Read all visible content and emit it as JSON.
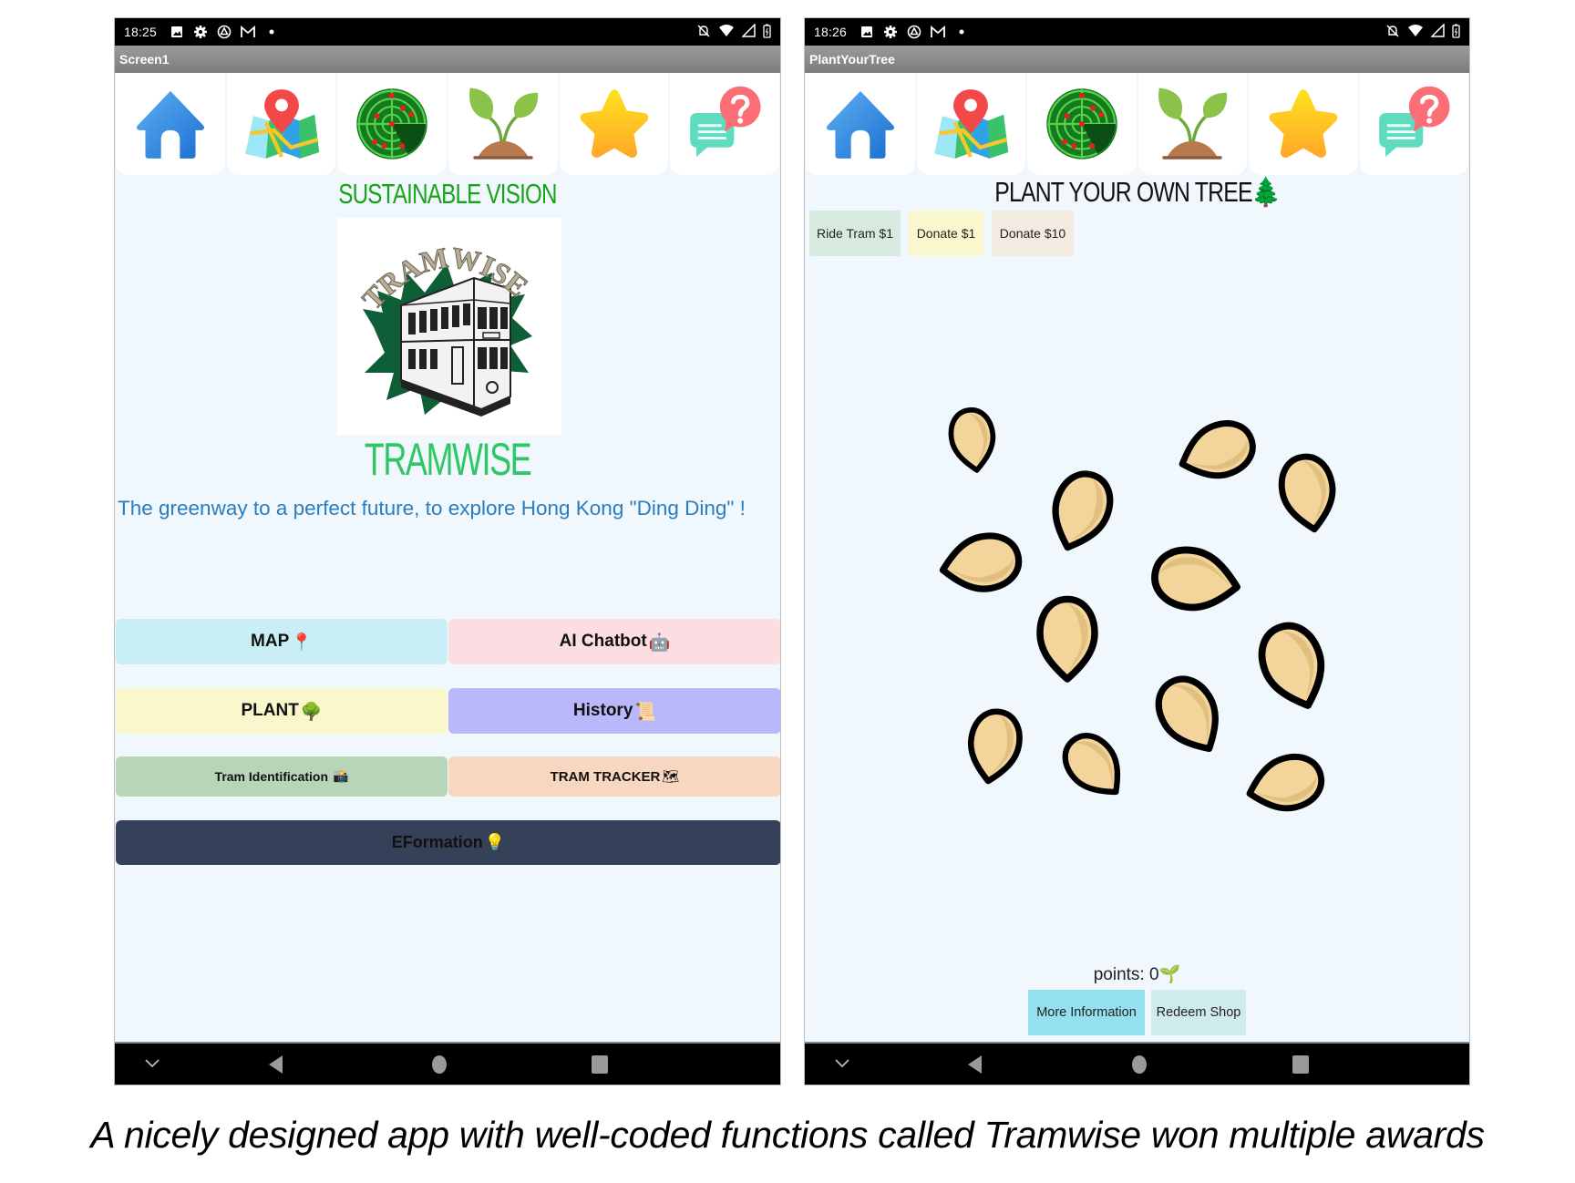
{
  "caption": "A nicely designed app with well-coded functions called Tramwise won multiple awards",
  "colors": {
    "screen_bg": "#f0f7fd",
    "heading_green": "#19a319",
    "brand_green": "#2fc665",
    "tagline_blue": "#2a7dbf"
  },
  "top_icons": [
    "home-icon",
    "map-pin-icon",
    "radar-icon",
    "sprout-icon",
    "star-icon",
    "help-chat-icon"
  ],
  "phone_left": {
    "status": {
      "time": "18:25"
    },
    "title": "Screen1",
    "heading": "SUSTAINABLE VISION",
    "logo_text": "TRAMWISE",
    "brand": "TRAMWISE",
    "tagline": "The greenway to a perfect future, to explore Hong Kong \"Ding Ding\" !",
    "buttons": [
      {
        "label": "MAP",
        "emoji": "📍",
        "color": "#c9eef6"
      },
      {
        "label": "AI Chatbot",
        "emoji": "🤖",
        "color": "#fbdde2"
      },
      {
        "label": "PLANT",
        "emoji": "🌳",
        "color": "#fbf7cd"
      },
      {
        "label": "History",
        "emoji": "📜",
        "color": "#b8b8fa"
      },
      {
        "label": "Tram Identification",
        "emoji": "📸",
        "color": "#b8d5b7"
      },
      {
        "label": "TRAM TRACKER",
        "emoji": "🗺",
        "color": "#f8d7c1"
      },
      {
        "label": "EFormation",
        "emoji": "💡",
        "color": "#344159"
      }
    ]
  },
  "phone_right": {
    "status": {
      "time": "18:26"
    },
    "title": "PlantYourTree",
    "heading": "PLANT YOUR OWN TREE",
    "heading_emoji": "🌲",
    "actions": [
      {
        "label": "Ride Tram $1",
        "color": "#d8eadf"
      },
      {
        "label": "Donate $1",
        "color": "#fbf7cd"
      },
      {
        "label": "Donate $10",
        "color": "#f3eae1"
      }
    ],
    "seed_count": 13,
    "points_label": "points: ",
    "points_value": "0",
    "points_emoji": "🌱",
    "bottom_buttons": [
      {
        "label": "More Information",
        "color": "#94e0ef"
      },
      {
        "label": "Redeem Shop",
        "color": "#cfebec"
      }
    ]
  }
}
